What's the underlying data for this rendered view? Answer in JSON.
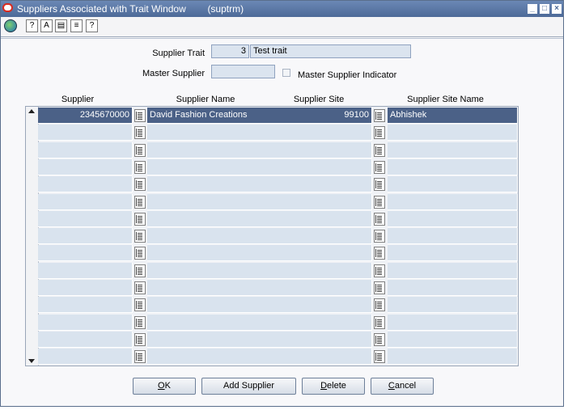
{
  "window": {
    "title": "Suppliers Associated with Trait Window",
    "form_code": "(suptrm)"
  },
  "form": {
    "supplier_trait_label": "Supplier Trait",
    "supplier_trait_id": "3",
    "supplier_trait_desc": "Test trait",
    "master_supplier_label": "Master Supplier",
    "master_supplier_value": "",
    "master_supplier_indicator_label": "Master Supplier Indicator",
    "master_supplier_indicator_checked": false
  },
  "table": {
    "headers": [
      "Supplier",
      "Supplier Name",
      "Supplier Site",
      "Supplier Site Name"
    ],
    "rows": [
      {
        "supplier": "2345670000",
        "supplier_name": "David Fashion Creations",
        "supplier_site": "99100",
        "supplier_site_name": "Abhishek"
      },
      {
        "supplier": "",
        "supplier_name": "",
        "supplier_site": "",
        "supplier_site_name": ""
      },
      {
        "supplier": "",
        "supplier_name": "",
        "supplier_site": "",
        "supplier_site_name": ""
      },
      {
        "supplier": "",
        "supplier_name": "",
        "supplier_site": "",
        "supplier_site_name": ""
      },
      {
        "supplier": "",
        "supplier_name": "",
        "supplier_site": "",
        "supplier_site_name": ""
      },
      {
        "supplier": "",
        "supplier_name": "",
        "supplier_site": "",
        "supplier_site_name": ""
      },
      {
        "supplier": "",
        "supplier_name": "",
        "supplier_site": "",
        "supplier_site_name": ""
      },
      {
        "supplier": "",
        "supplier_name": "",
        "supplier_site": "",
        "supplier_site_name": ""
      },
      {
        "supplier": "",
        "supplier_name": "",
        "supplier_site": "",
        "supplier_site_name": ""
      },
      {
        "supplier": "",
        "supplier_name": "",
        "supplier_site": "",
        "supplier_site_name": ""
      },
      {
        "supplier": "",
        "supplier_name": "",
        "supplier_site": "",
        "supplier_site_name": ""
      },
      {
        "supplier": "",
        "supplier_name": "",
        "supplier_site": "",
        "supplier_site_name": ""
      },
      {
        "supplier": "",
        "supplier_name": "",
        "supplier_site": "",
        "supplier_site_name": ""
      },
      {
        "supplier": "",
        "supplier_name": "",
        "supplier_site": "",
        "supplier_site_name": ""
      },
      {
        "supplier": "",
        "supplier_name": "",
        "supplier_site": "",
        "supplier_site_name": ""
      }
    ]
  },
  "buttons": {
    "ok": {
      "mnemonic": "O",
      "rest": "K"
    },
    "add_supplier": "Add Supplier",
    "delete": {
      "mnemonic": "D",
      "rest": "elete"
    },
    "cancel": {
      "mnemonic": "C",
      "rest": "ancel"
    }
  },
  "icons": {
    "app": "oracle-app-icon",
    "toolbar": [
      "globe-icon",
      "lookup-icon",
      "spell-check-icon",
      "calendar-icon",
      "print-icon",
      "help-icon"
    ],
    "lov": "list-of-values-icon"
  },
  "colors": {
    "selected_row": "#4b6187",
    "cell": "#d9e3ee",
    "titlebar": "#5877a8"
  }
}
